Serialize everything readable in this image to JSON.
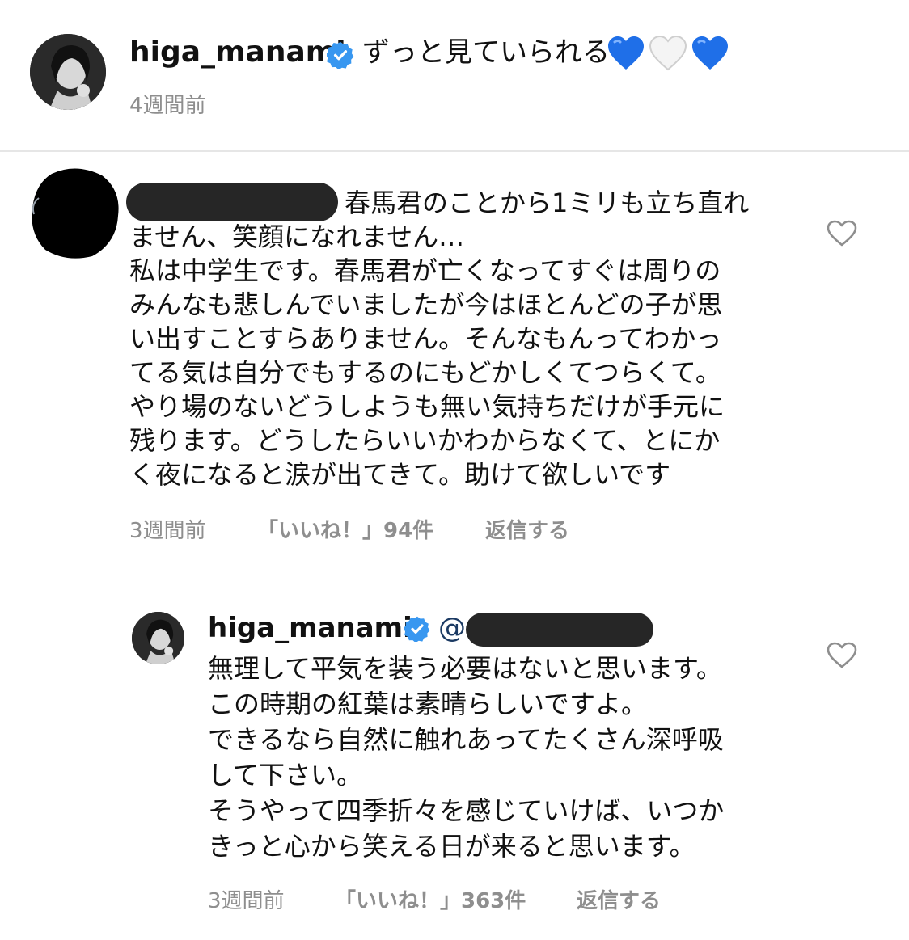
{
  "post": {
    "author": "higa_manami",
    "caption": "ずっと見ていられる",
    "caption_emoji": [
      "blue-heart",
      "white-heart",
      "blue-heart"
    ],
    "time": "4週間前"
  },
  "comment": {
    "text_line1": "春馬君のことから1ミリも立ち直れ",
    "text_lines": [
      "ません、笑顔になれません…",
      "私は中学生です。春馬君が亡くなってすぐは周りの",
      "みんなも悲しんでいましたが今はほとんどの子が思",
      "い出すことすらありません。そんなもんってわかっ",
      "てる気は自分でもするのにもどかしくてつらくて。",
      "やり場のないどうしようも無い気持ちだけが手元に",
      "残ります。どうしたらいいかわからなくて、とにか",
      "く夜になると涙が出てきて。助けて欲しいです"
    ],
    "time": "3週間前",
    "likes": "「いいね！」94件",
    "reply_label": "返信する"
  },
  "reply": {
    "author": "higa_manami",
    "mention_prefix": "@",
    "text_lines": [
      "無理して平気を装う必要はないと思います。",
      "この時期の紅葉は素晴らしいですよ。",
      "できるなら自然に触れあってたくさん深呼吸",
      "して下さい。",
      "そうやって四季折々を感じていけば、いつか",
      "きっと心から笑える日が来ると思います。"
    ],
    "time": "3週間前",
    "likes": "「いいね！」363件",
    "reply_label": "返信する"
  },
  "colors": {
    "verified": "#3897f0",
    "meta_text": "#8e8e8e",
    "blue_heart": "#1f6fe8",
    "redaction": "#262626",
    "divider": "#e6e6e6"
  }
}
